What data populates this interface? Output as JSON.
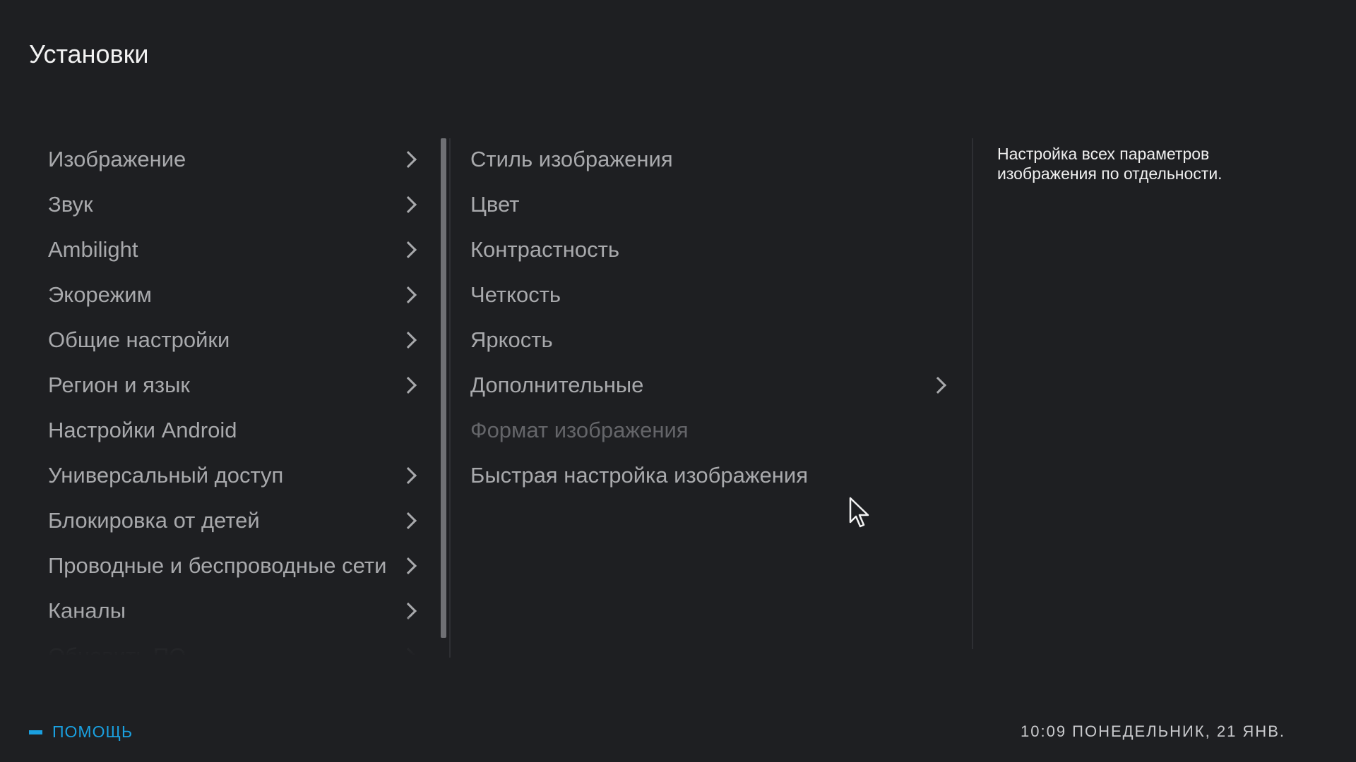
{
  "header": {
    "title": "Установки"
  },
  "left_menu": {
    "items": [
      {
        "label": "Изображение",
        "has_submenu": true
      },
      {
        "label": "Звук",
        "has_submenu": true
      },
      {
        "label": "Ambilight",
        "has_submenu": true
      },
      {
        "label": "Экорежим",
        "has_submenu": true
      },
      {
        "label": "Общие настройки",
        "has_submenu": true
      },
      {
        "label": "Регион и язык",
        "has_submenu": true
      },
      {
        "label": "Настройки Android",
        "has_submenu": false
      },
      {
        "label": "Универсальный доступ",
        "has_submenu": true
      },
      {
        "label": "Блокировка от детей",
        "has_submenu": true
      },
      {
        "label": "Проводные и беспроводные сети",
        "has_submenu": true
      },
      {
        "label": "Каналы",
        "has_submenu": true
      },
      {
        "label": "Обновить ПО",
        "has_submenu": true
      }
    ]
  },
  "mid_menu": {
    "items": [
      {
        "label": "Стиль изображения",
        "has_submenu": false,
        "disabled": false
      },
      {
        "label": "Цвет",
        "has_submenu": false,
        "disabled": false
      },
      {
        "label": "Контрастность",
        "has_submenu": false,
        "disabled": false
      },
      {
        "label": "Четкость",
        "has_submenu": false,
        "disabled": false
      },
      {
        "label": "Яркость",
        "has_submenu": false,
        "disabled": false
      },
      {
        "label": "Дополнительные",
        "has_submenu": true,
        "disabled": false
      },
      {
        "label": "Формат изображения",
        "has_submenu": false,
        "disabled": true
      },
      {
        "label": "Быстрая настройка изображения",
        "has_submenu": false,
        "disabled": false
      }
    ]
  },
  "description": {
    "text": "Настройка всех параметров изображения по отдельности."
  },
  "footer": {
    "help_label": "ПОМОЩЬ",
    "help_key_color": "#1aa0e0",
    "clock": "10:09 ПОНЕДЕЛЬНИК, 21 ЯНВ."
  },
  "icons": {
    "submenu": "chevron-right-icon",
    "cursor": "mouse-cursor-icon",
    "help_key": "blue-key-icon"
  }
}
